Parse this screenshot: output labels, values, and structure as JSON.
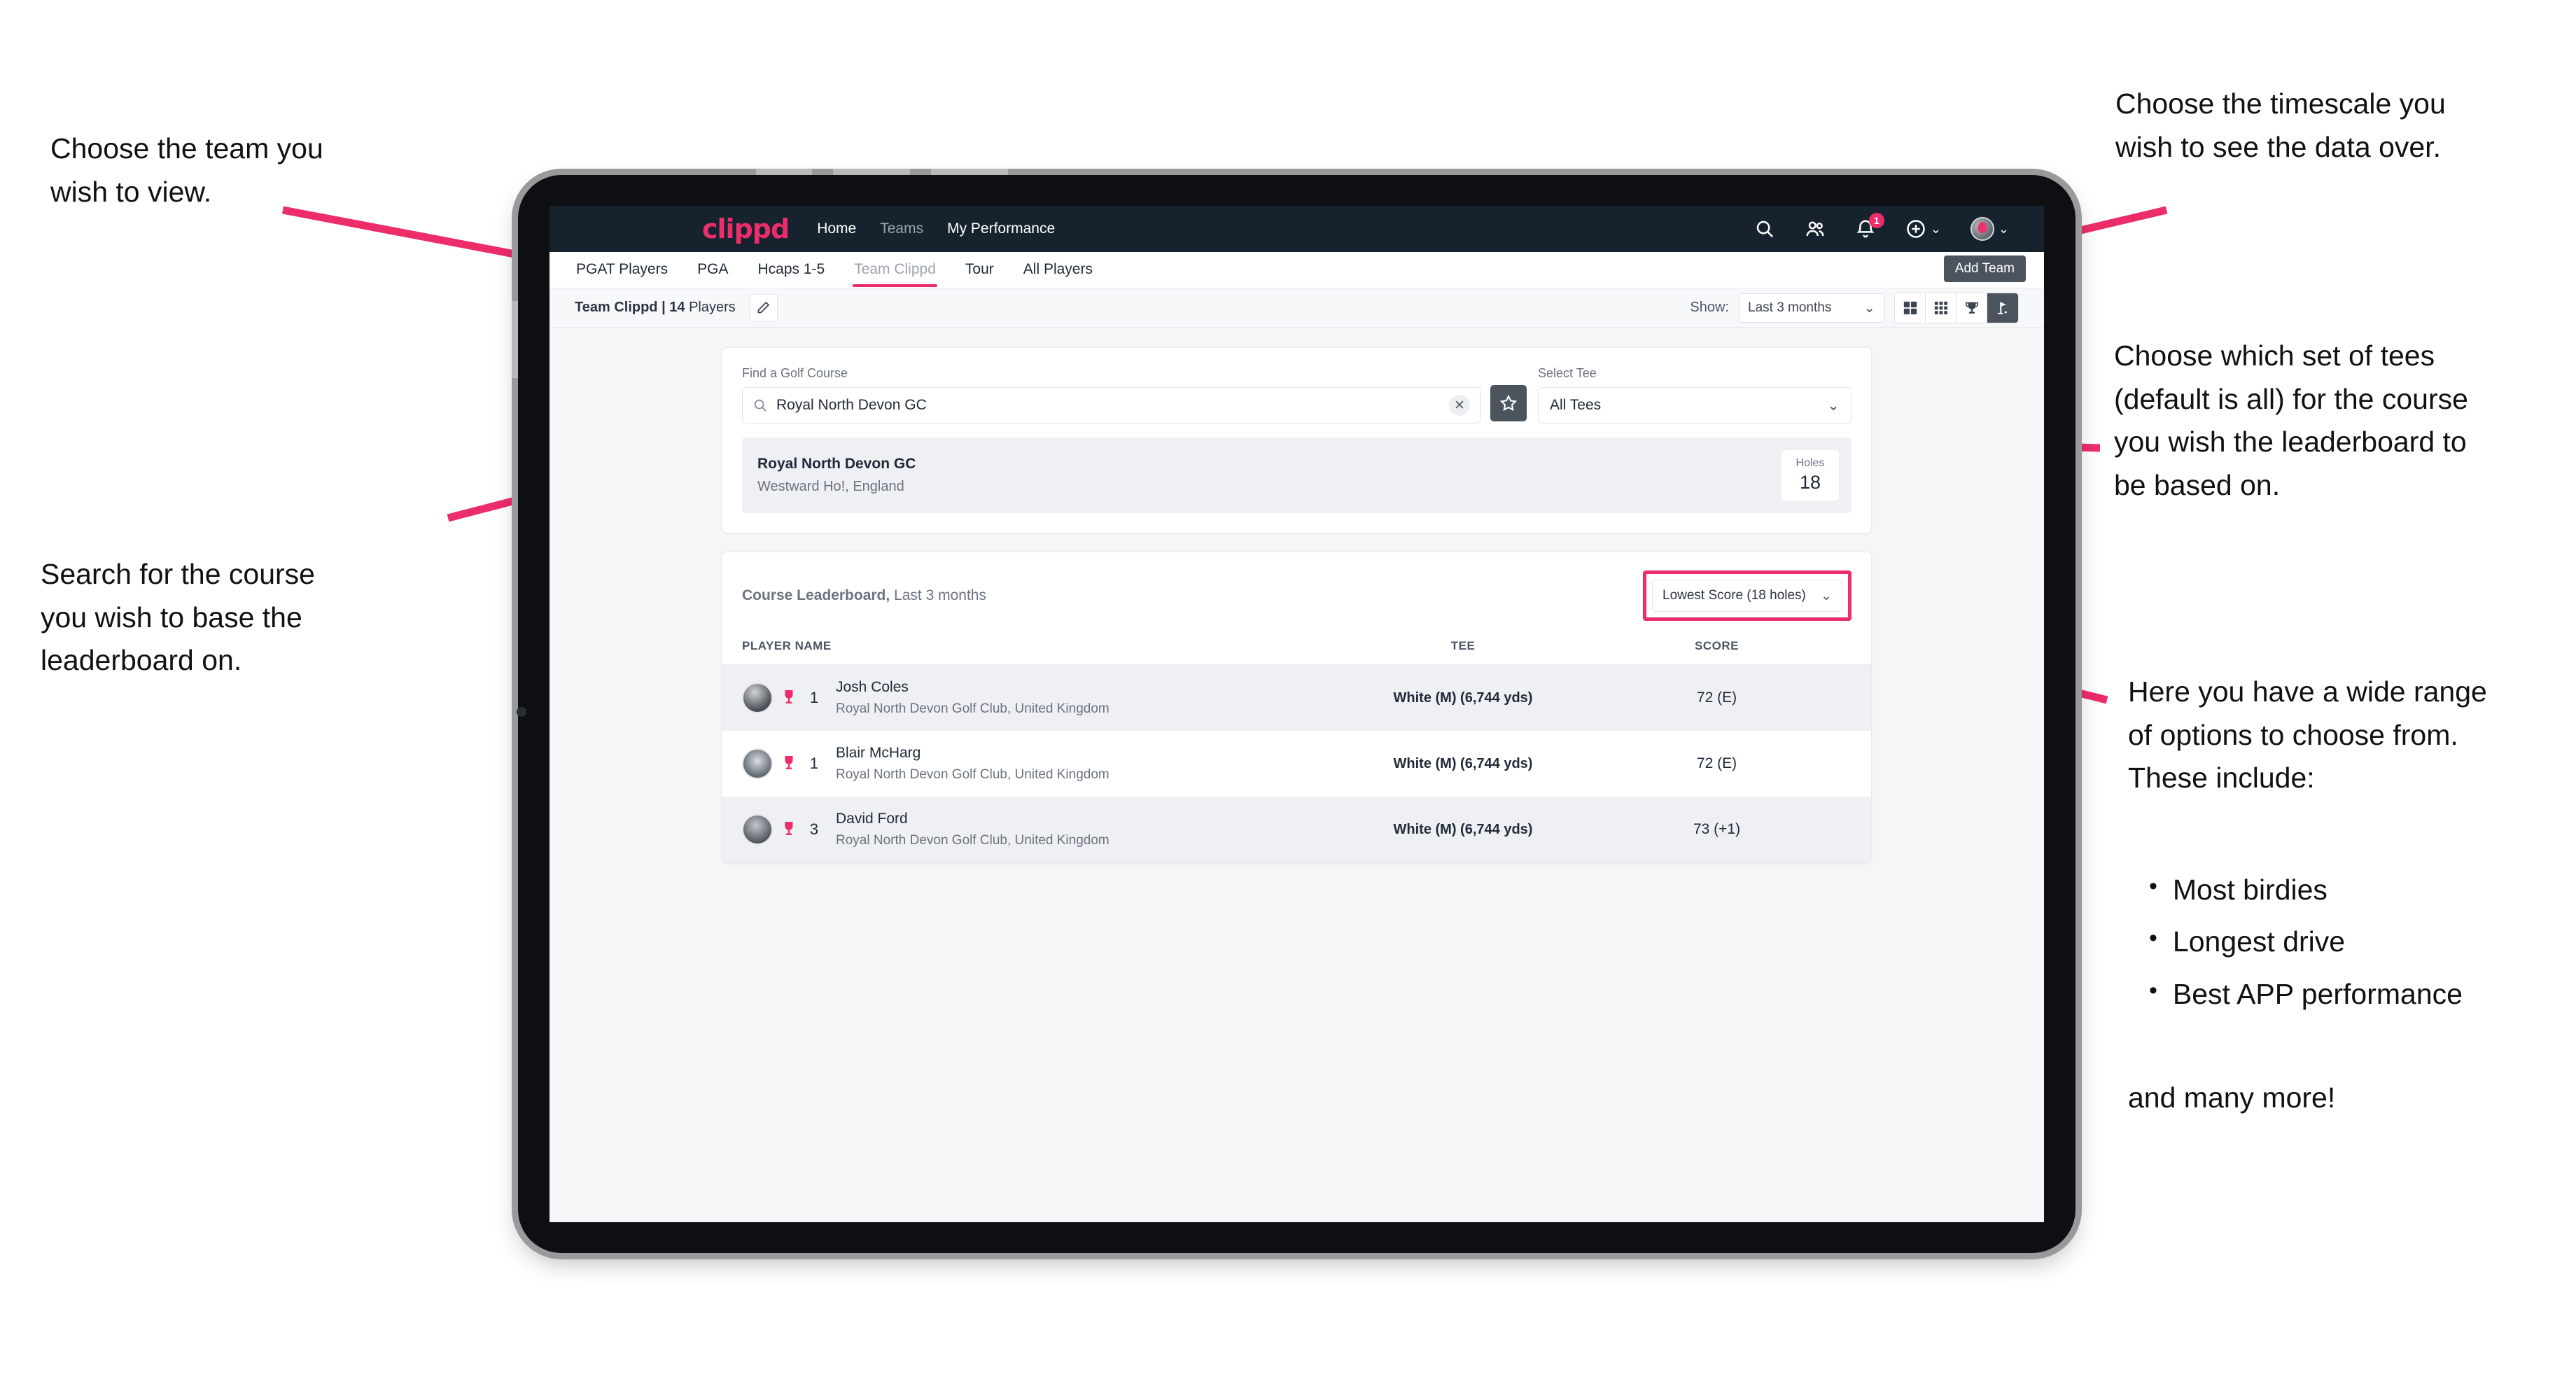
{
  "annotations": {
    "team": "Choose the team you\nwish to view.",
    "search": "Search for the course\nyou wish to base the\nleaderboard on.",
    "timescale": "Choose the timescale you\nwish to see the data over.",
    "tees": "Choose which set of tees\n(default is all) for the course\nyou wish the leaderboard to\nbe based on.",
    "options_intro": "Here you have a wide range\nof options to choose from.\nThese include:",
    "options_list": [
      "Most birdies",
      "Longest drive",
      "Best APP performance"
    ],
    "options_outro": "and many more!"
  },
  "app": {
    "logo": "clippd",
    "nav": [
      {
        "label": "Home",
        "active": true
      },
      {
        "label": "Teams",
        "active": false
      },
      {
        "label": "My Performance",
        "active": true
      }
    ],
    "icons": {
      "search": "search-icon",
      "people": "people-icon",
      "bell": "bell-icon",
      "bell_badge": "1",
      "add": "plus-circle-icon",
      "avatar": "user-avatar"
    },
    "tabs": [
      {
        "label": "PGAT Players",
        "active": false,
        "muted": false
      },
      {
        "label": "PGA",
        "active": false,
        "muted": false
      },
      {
        "label": "Hcaps 1-5",
        "active": false,
        "muted": false
      },
      {
        "label": "Team Clippd",
        "active": true,
        "muted": true
      },
      {
        "label": "Tour",
        "active": false,
        "muted": false
      },
      {
        "label": "All Players",
        "active": false,
        "muted": false
      }
    ],
    "add_team_tooltip": "Add Team"
  },
  "toolbar": {
    "team_name": "Team Clippd",
    "separator": "|",
    "player_count": "14",
    "players_word": "Players",
    "edit_icon": "pencil-icon",
    "show_label": "Show:",
    "show_value": "Last 3 months",
    "views": [
      {
        "name": "grid-4-view",
        "selected": false
      },
      {
        "name": "grid-9-view",
        "selected": false
      },
      {
        "name": "trophy-view",
        "selected": false
      },
      {
        "name": "flag-view",
        "selected": true
      }
    ]
  },
  "search_card": {
    "course_label": "Find a Golf Course",
    "course_value": "Royal North Devon GC",
    "course_placeholder": "Find a Golf Course",
    "clear_icon": "close-icon",
    "favorite_icon": "star-icon",
    "tee_label": "Select Tee",
    "tee_value": "All Tees",
    "result": {
      "name": "Royal North Devon GC",
      "location": "Westward Ho!, England",
      "holes_label": "Holes",
      "holes_value": "18"
    }
  },
  "leaderboard": {
    "title": "Course Leaderboard,",
    "subtitle": " Last 3 months",
    "sort_value": "Lowest Score (18 holes)",
    "columns": {
      "name": "PLAYER NAME",
      "tee": "TEE",
      "score": "SCORE"
    },
    "rows": [
      {
        "rank": "1",
        "name": "Josh Coles",
        "club": "Royal North Devon Golf Club, United Kingdom",
        "tee": "White (M) (6,744 yds)",
        "score": "72 (E)"
      },
      {
        "rank": "1",
        "name": "Blair McHarg",
        "club": "Royal North Devon Golf Club, United Kingdom",
        "tee": "White (M) (6,744 yds)",
        "score": "72 (E)"
      },
      {
        "rank": "3",
        "name": "David Ford",
        "club": "Royal North Devon Golf Club, United Kingdom",
        "tee": "White (M) (6,744 yds)",
        "score": "73 (+1)"
      }
    ]
  },
  "colors": {
    "accent": "#ec2d69",
    "appbar": "#16232e",
    "dark_chip": "#4b535c"
  }
}
